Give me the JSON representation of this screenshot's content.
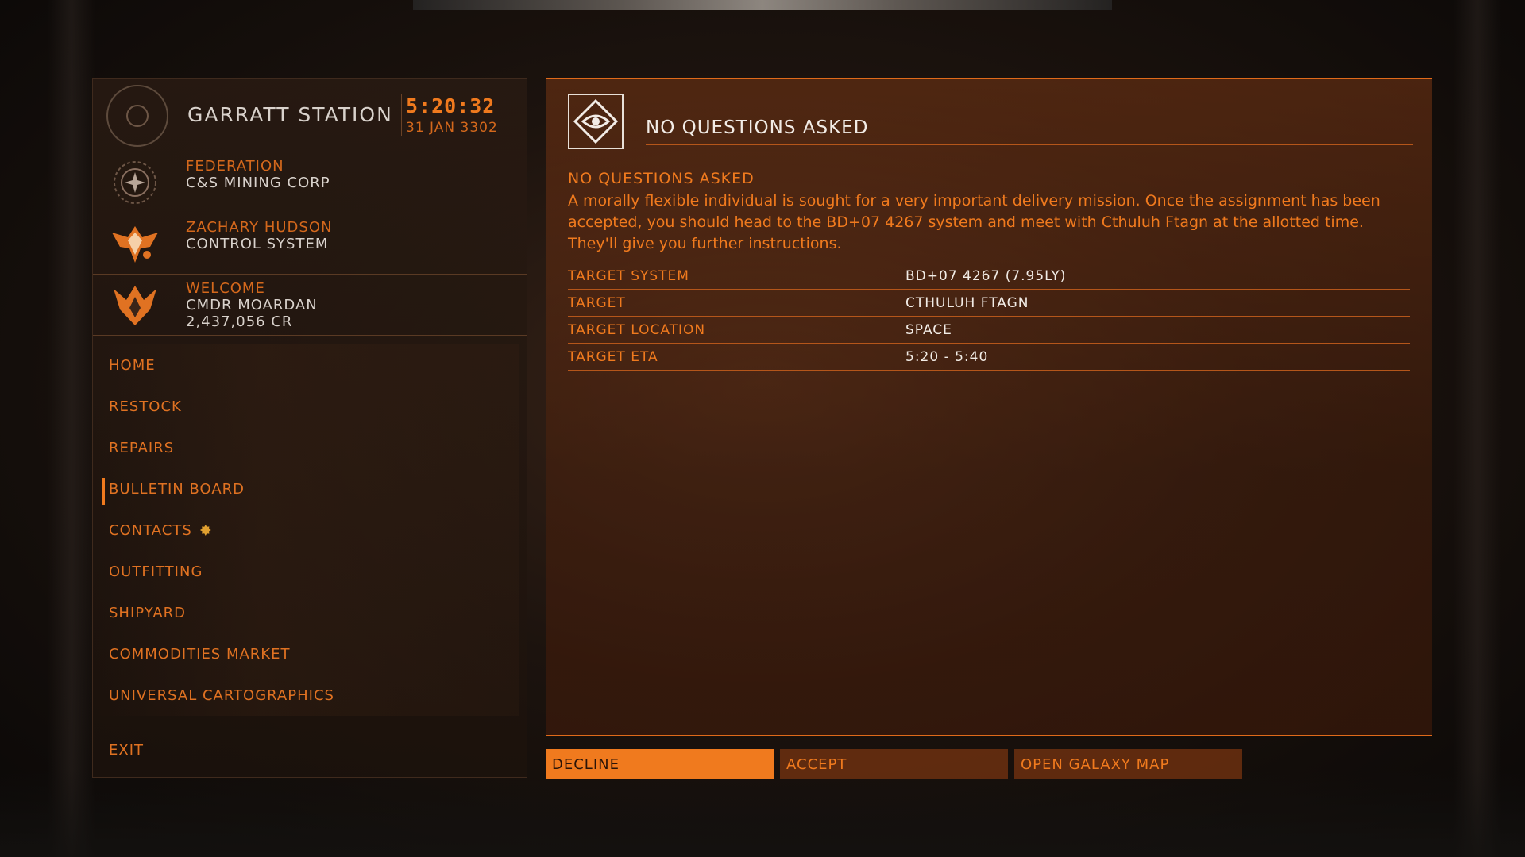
{
  "station": {
    "name": "GARRATT STATION",
    "time": "5:20:32",
    "date": "31 JAN 3302"
  },
  "faction": {
    "allegiance": "FEDERATION",
    "controller": "C&S MINING CORP"
  },
  "power": {
    "name": "ZACHARY HUDSON",
    "status": "CONTROL SYSTEM"
  },
  "commander": {
    "greeting": "WELCOME",
    "name": "CMDR MOARDAN",
    "credits": "2,437,056 CR"
  },
  "menu": {
    "items": [
      {
        "label": "HOME"
      },
      {
        "label": "RESTOCK"
      },
      {
        "label": "REPAIRS"
      },
      {
        "label": "BULLETIN BOARD"
      },
      {
        "label": "CONTACTS"
      },
      {
        "label": "OUTFITTING"
      },
      {
        "label": "SHIPYARD"
      },
      {
        "label": "COMMODITIES MARKET"
      },
      {
        "label": "UNIVERSAL CARTOGRAPHICS"
      }
    ],
    "exit_label": "EXIT",
    "active_index": 3
  },
  "mission": {
    "header_title": "NO QUESTIONS ASKED",
    "subtitle": "NO QUESTIONS ASKED",
    "description": "A morally flexible individual is sought for a very important delivery mission. Once the assignment has been accepted, you should head to the BD+07 4267 system and meet with Cthuluh Ftagn at the allotted time. They'll give you further instructions.",
    "details": [
      {
        "label": "TARGET SYSTEM",
        "value": "BD+07 4267 (7.95LY)"
      },
      {
        "label": "TARGET",
        "value": "CTHULUH FTAGN"
      },
      {
        "label": "TARGET LOCATION",
        "value": "SPACE"
      },
      {
        "label": "TARGET ETA",
        "value": "5:20 - 5:40"
      }
    ]
  },
  "actions": {
    "decline": "DECLINE",
    "accept": "ACCEPT",
    "galaxy_map": "OPEN GALAXY MAP"
  },
  "colors": {
    "accent": "#f07a1e",
    "accent_dark": "#d4681c",
    "text_light": "#f2ece6"
  },
  "icons": {
    "station": "station-ring-icon",
    "faction": "federation-emblem-icon",
    "power": "zachary-hudson-emblem-icon",
    "rank": "pilot-rank-icon",
    "mission": "eye-diamond-icon",
    "contacts_alert": "gear-alert-icon"
  }
}
